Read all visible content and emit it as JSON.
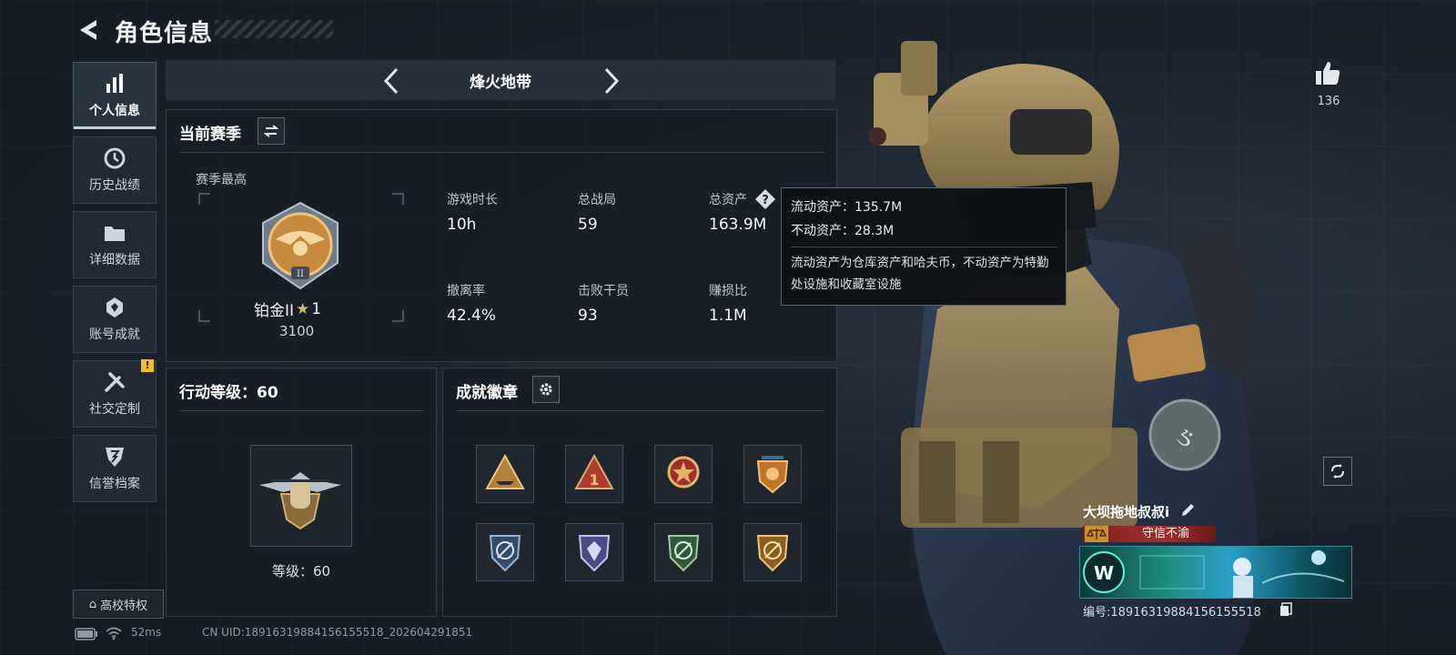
{
  "header": {
    "title": "角色信息"
  },
  "nav": {
    "items": [
      {
        "label": "个人信息",
        "icon": "bar-chart-icon",
        "active": true
      },
      {
        "label": "历史战绩",
        "icon": "clock-icon",
        "active": false
      },
      {
        "label": "详细数据",
        "icon": "folder-icon",
        "active": false
      },
      {
        "label": "账号成就",
        "icon": "achievement-icon",
        "active": false
      },
      {
        "label": "社交定制",
        "icon": "tools-icon",
        "active": false,
        "badge": "!"
      },
      {
        "label": "信誉档案",
        "icon": "shield-icon",
        "active": false
      }
    ],
    "campus_label": "高校特权"
  },
  "mode": {
    "title": "烽火地带"
  },
  "season": {
    "heading": "当前赛季",
    "best_label": "赛季最高",
    "rank_name": "铂金II",
    "rank_stars": "1",
    "rank_score": "3100",
    "stats": [
      {
        "label": "游戏时长",
        "value": "10h"
      },
      {
        "label": "总战局",
        "value": "59"
      },
      {
        "label": "总资产",
        "value": "163.9M"
      },
      {
        "label": "撤离率",
        "value": "42.4%"
      },
      {
        "label": "击败干员",
        "value": "93"
      },
      {
        "label": "赚损比",
        "value": "1.1M"
      }
    ]
  },
  "tooltip": {
    "liquid": "流动资产：135.7M",
    "fixed": "不动资产：28.3M",
    "description": "流动资产为仓库资产和哈夫币，不动资产为特勤处设施和收藏室设施"
  },
  "level": {
    "heading": "行动等级：60",
    "label": "等级：60"
  },
  "achievements": {
    "heading": "成就徽章",
    "badges": [
      {
        "name": "badge-triangle-ship-icon"
      },
      {
        "name": "badge-triangle-number-icon"
      },
      {
        "name": "badge-star-emblem-icon"
      },
      {
        "name": "badge-stars-shield-icon"
      },
      {
        "name": "badge-blue-shield-icon"
      },
      {
        "name": "badge-purple-shield-icon"
      },
      {
        "name": "badge-green-shield-icon"
      },
      {
        "name": "badge-gold-shield-icon"
      }
    ]
  },
  "status": {
    "ping": "52ms",
    "uid": "CN UID:18916319884156155518_202604291851"
  },
  "profile": {
    "likes": "136",
    "name": "大坝拖地叔叔i",
    "honor": "守信不渝",
    "id_text": "编号:18916319884156155518"
  },
  "colors": {
    "accent": "#f0c020",
    "honor": "#a4302a",
    "panel": "#181e25"
  }
}
